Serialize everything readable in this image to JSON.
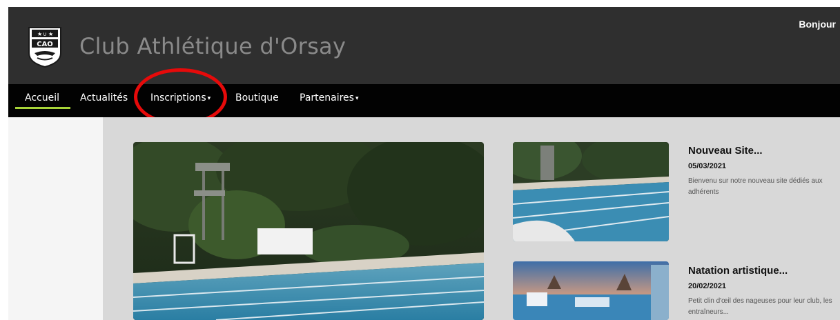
{
  "header": {
    "site_title": "Club Athlétique d'Orsay",
    "greeting": "Bonjour",
    "logo_text": "CAO",
    "logo_icon": "club-crest-icon",
    "background": "#2f2f2f"
  },
  "nav": {
    "items": [
      {
        "label": "Accueil",
        "active": true,
        "dropdown": false
      },
      {
        "label": "Actualités",
        "active": false,
        "dropdown": false
      },
      {
        "label": "Inscriptions",
        "active": false,
        "dropdown": true
      },
      {
        "label": "Boutique",
        "active": false,
        "dropdown": false
      },
      {
        "label": "Partenaires",
        "active": false,
        "dropdown": true
      }
    ],
    "caret": "▾",
    "active_color": "#a7d438",
    "highlighted_item": "Inscriptions",
    "highlight_color": "#e60a0a"
  },
  "content": {
    "hero_image": "outdoor-swimming-pool-with-diving-tower",
    "news": [
      {
        "title": "Nouveau Site...",
        "date": "05/03/2021",
        "excerpt": "Bienvenu sur notre nouveau site dédiés aux adhérents",
        "image": "pool-lanes-thumbnail"
      },
      {
        "title": "Natation artistique...",
        "date": "20/02/2021",
        "excerpt": "Petit clin d'œil des nageuses pour leur club, les entraîneurs...",
        "image": "pool-sunset-thumbnail"
      }
    ]
  }
}
